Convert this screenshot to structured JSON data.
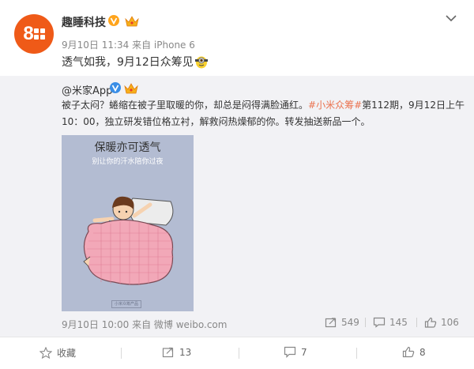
{
  "post": {
    "author": "趣睡科技",
    "meta": "9月10日 11:34 来自 iPhone 6",
    "text": "透气如我，9月12日众筹见",
    "avatar_text": "8"
  },
  "repost": {
    "author": "@米家App",
    "text_before": "被子太闷？蜷缩在被子里取暖的你，却总是闷得满脸通红。",
    "tag": "#小米众筹#",
    "text_after": "第112期，9月12日上午10：00，独立研发错位格立衬，解救闷热燥郁的你。转发抽送新品一个。",
    "image_title": "保暖亦可透气",
    "image_subtitle": "别让你的汗水陪你过夜",
    "image_tag": "小米众筹产品",
    "footer_meta": "9月10日 10:00 来自 微博 weibo.com",
    "stats": {
      "repost": "549",
      "comment": "145",
      "like": "106"
    }
  },
  "actions": {
    "favorite": "收藏",
    "repost": "13",
    "comment": "7",
    "like": "8"
  },
  "colors": {
    "accent": "#eb7350",
    "avatar": "#ef5a18",
    "repost_bg": "#f2f2f5"
  }
}
